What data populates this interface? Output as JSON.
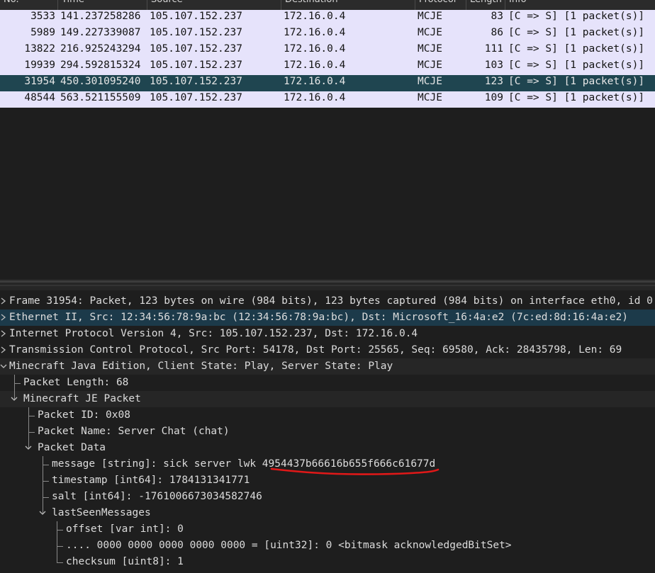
{
  "columns": [
    "No.",
    "Time",
    "Source",
    "Destination",
    "Protocol",
    "Length",
    "Info"
  ],
  "packets": [
    {
      "no": "3533",
      "time": "141.237258286",
      "src": "105.107.152.237",
      "dst": "172.16.0.4",
      "proto": "MCJE",
      "len": "83",
      "info": "[C => S] [1 packet(s)]"
    },
    {
      "no": "5989",
      "time": "149.227339087",
      "src": "105.107.152.237",
      "dst": "172.16.0.4",
      "proto": "MCJE",
      "len": "86",
      "info": "[C => S] [1 packet(s)]"
    },
    {
      "no": "13822",
      "time": "216.925243294",
      "src": "105.107.152.237",
      "dst": "172.16.0.4",
      "proto": "MCJE",
      "len": "111",
      "info": "[C => S] [1 packet(s)]"
    },
    {
      "no": "19939",
      "time": "294.592815324",
      "src": "105.107.152.237",
      "dst": "172.16.0.4",
      "proto": "MCJE",
      "len": "103",
      "info": "[C => S] [1 packet(s)]"
    },
    {
      "no": "31954",
      "time": "450.301095240",
      "src": "105.107.152.237",
      "dst": "172.16.0.4",
      "proto": "MCJE",
      "len": "123",
      "info": "[C => S] [1 packet(s)]"
    },
    {
      "no": "48544",
      "time": "563.521155509",
      "src": "105.107.152.237",
      "dst": "172.16.0.4",
      "proto": "MCJE",
      "len": "109",
      "info": "[C => S] [1 packet(s)]"
    }
  ],
  "selected_packet": "31954",
  "tree": [
    {
      "text": "Frame 31954: Packet, 123 bytes on wire (984 bits), 123 bytes captured (984 bits) on interface eth0, id 0",
      "arrow": "right"
    },
    {
      "text": "Ethernet II, Src: 12:34:56:78:9a:bc (12:34:56:78:9a:bc), Dst: Microsoft_16:4a:e2 (7c:ed:8d:16:4a:e2)",
      "arrow": "right"
    },
    {
      "text": "Internet Protocol Version 4, Src: 105.107.152.237, Dst: 172.16.0.4",
      "arrow": "right"
    },
    {
      "text": "Transmission Control Protocol, Src Port: 54178, Dst Port: 25565, Seq: 69580, Ack: 28435798, Len: 69",
      "arrow": "right"
    },
    {
      "text": "Minecraft Java Edition, Client State: Play, Server State: Play",
      "arrow": "down"
    },
    {
      "text": "Packet Length: 68"
    },
    {
      "text": "Minecraft JE Packet",
      "arrow": "down"
    },
    {
      "text": "Packet ID: 0x08"
    },
    {
      "text": "Packet Name: Server Chat (chat)"
    },
    {
      "text": "Packet Data",
      "arrow": "down"
    },
    {
      "text": "message [string]: sick server lwk 4954437b66616b655f666c61677d"
    },
    {
      "text": "timestamp [int64]: 1784131341771"
    },
    {
      "text": "salt [int64]: -1761006673034582746"
    },
    {
      "text": "lastSeenMessages",
      "arrow": "down"
    },
    {
      "text": "offset [var int]: 0"
    },
    {
      "text": ".... 0000  0000 0000  0000 0000 = [uint32]: 0 <bitmask acknowledgedBitSet>"
    },
    {
      "text": "checksum [uint8]: 1"
    }
  ],
  "colors": {
    "row_bg": "#e6e3fb",
    "row_selected_bg": "#1f4550",
    "annotation_underline": "#e01818"
  },
  "icons": [
    "tree-expand-icon",
    "tree-collapse-icon"
  ]
}
